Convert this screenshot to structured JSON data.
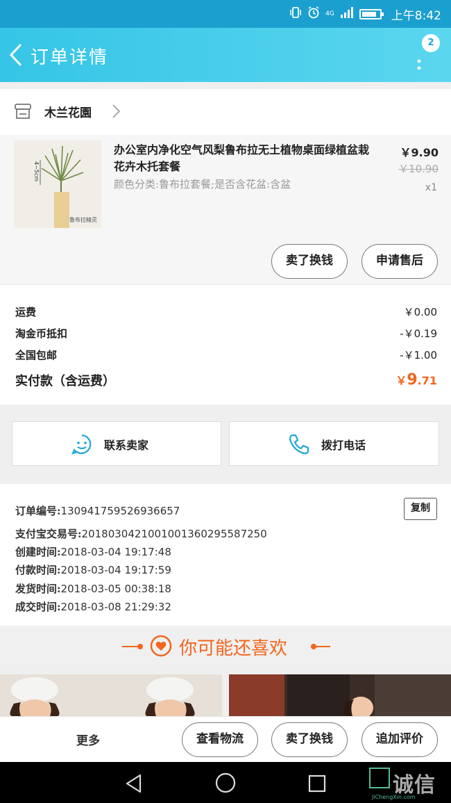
{
  "status_bar": {
    "net": "4G",
    "time": "上午8:42"
  },
  "header": {
    "title": "订单详情",
    "badge": "2"
  },
  "shop": {
    "name": "木兰花園"
  },
  "product": {
    "title": "办公室内净化空气风梨鲁布拉无土植物桌面绿植盆栽花卉木托套餐",
    "spec": "颜色分类:鲁布拉套餐;是否含花盆:含盆",
    "price": "￥9.90",
    "original_price": "￥10.90",
    "quantity": "x1",
    "thumb_size": "4~5cm",
    "thumb_label": "鲁布拉精灵"
  },
  "product_actions": {
    "resell": "卖了换钱",
    "after_sale": "申请售后"
  },
  "fees": {
    "shipping_label": "运费",
    "shipping_value": "￥0.00",
    "coin_label": "淘金币抵扣",
    "coin_value": "-￥0.19",
    "free_ship_label": "全国包邮",
    "free_ship_value": "-￥1.00",
    "total_label": "实付款（含运费）",
    "total_symbol": "￥",
    "total_int": "9",
    "total_dec": ".71"
  },
  "contact": {
    "seller": "联系卖家",
    "call": "拨打电话"
  },
  "order_info": {
    "order_no_label": "订单编号:",
    "order_no": "1309417595269366​57",
    "alipay_label": "支付宝交易号:",
    "alipay_no": "2018030421001001360295587250",
    "created_label": "创建时间:",
    "created": "2018-03-04 19:17:48",
    "paid_label": "付款时间:",
    "paid": "2018-03-04 19:17:59",
    "shipped_label": "发货时间:",
    "shipped": "2018-03-05 00:38:18",
    "completed_label": "成交时间:",
    "completed": "2018-03-08 21:29:32",
    "copy": "复制"
  },
  "recommend": {
    "title": "你可能还喜欢"
  },
  "bottom_bar": {
    "more": "更多",
    "logistics": "查看物流",
    "resell": "卖了换钱",
    "review": "追加评价"
  },
  "watermark": {
    "main": "诚信",
    "sub": "JiChengXin.com"
  },
  "colors": {
    "accent": "#f2661c",
    "nav": "#35c5e6",
    "contact_icon": "#1ca7d6"
  }
}
